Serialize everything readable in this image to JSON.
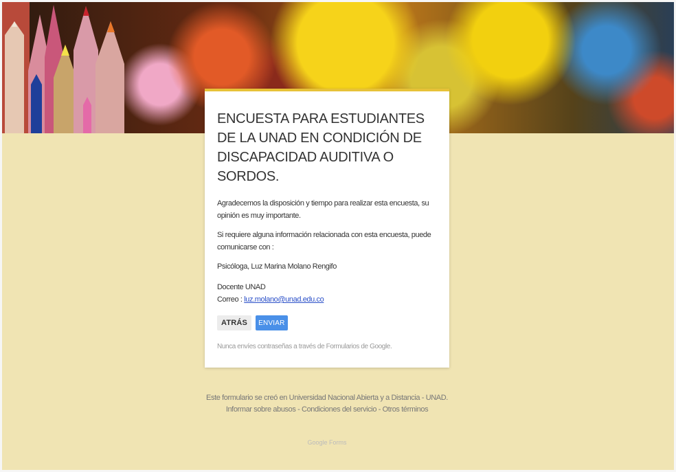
{
  "banner": {
    "image": "colored-pencils-bokeh-header"
  },
  "form": {
    "title": "ENCUESTA PARA ESTUDIANTES DE LA UNAD EN CONDICIÓN DE DISCAPACIDAD AUDITIVA O SORDOS.",
    "paragraph1": "Agradecemos la disposición y tiempo para realizar esta encuesta, su opinión es muy importante.",
    "paragraph2": "Si requiere alguna información relacionada con esta encuesta, puede comunicarse con :",
    "contact_name": "Psicóloga, Luz Marina Molano Rengifo",
    "contact_role": "Docente UNAD",
    "email_label": "Correo : ",
    "email": "luz.molano@unad.edu.co",
    "back_button": "ATRÁS",
    "send_button": "ENVIAR",
    "password_note": "Nunca envíes contraseñas a través de Formularios de Google."
  },
  "footer": {
    "text": "Este formulario se creó en Universidad Nacional Abierta y a Distancia - UNAD.",
    "report_abuse": "Informar sobre abusos",
    "terms": "Condiciones del servicio",
    "other_terms": "Otros términos",
    "google_forms": "Google Forms"
  },
  "colors": {
    "page_bg": "#f0e4b3",
    "accent": "#e7c238",
    "send_button": "#4a90e8",
    "link": "#2a4fc8"
  }
}
